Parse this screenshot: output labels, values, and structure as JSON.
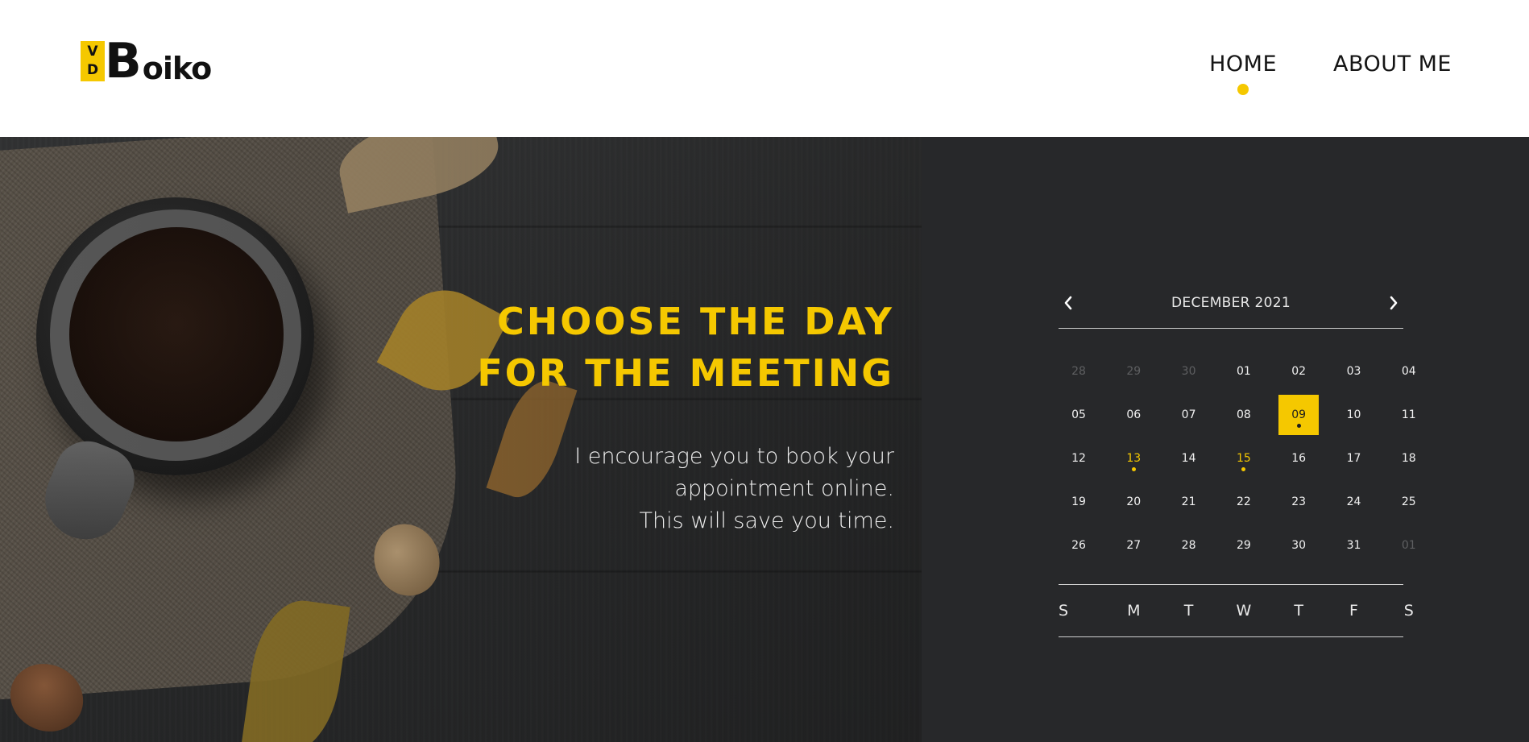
{
  "header": {
    "logo": {
      "mark_top": "V",
      "mark_bottom": "D",
      "big_letter": "B",
      "rest": "oiko"
    },
    "nav": [
      {
        "label": "HOME",
        "active": true
      },
      {
        "label": "ABOUT ME",
        "active": false
      }
    ]
  },
  "hero": {
    "title_line1": "CHOOSE THE DAY",
    "title_line2": "FOR THE MEETING",
    "sub_line1": "I encourage you to book your",
    "sub_line2": "appointment online.",
    "sub_line3": "This will save you time."
  },
  "calendar": {
    "month_label": "DECEMBER 2021",
    "prev_icon": "chevron-left-icon",
    "next_icon": "chevron-right-icon",
    "days": [
      {
        "label": "28",
        "muted": true
      },
      {
        "label": "29",
        "muted": true
      },
      {
        "label": "30",
        "muted": true
      },
      {
        "label": "01"
      },
      {
        "label": "02"
      },
      {
        "label": "03"
      },
      {
        "label": "04"
      },
      {
        "label": "05"
      },
      {
        "label": "06"
      },
      {
        "label": "07"
      },
      {
        "label": "08"
      },
      {
        "label": "09",
        "selected": true,
        "dot": true
      },
      {
        "label": "10"
      },
      {
        "label": "11"
      },
      {
        "label": "12"
      },
      {
        "label": "13",
        "event": true,
        "dot": true
      },
      {
        "label": "14"
      },
      {
        "label": "15",
        "event": true,
        "dot": true
      },
      {
        "label": "16"
      },
      {
        "label": "17"
      },
      {
        "label": "18"
      },
      {
        "label": "19"
      },
      {
        "label": "20"
      },
      {
        "label": "21"
      },
      {
        "label": "22"
      },
      {
        "label": "23"
      },
      {
        "label": "24"
      },
      {
        "label": "25"
      },
      {
        "label": "26"
      },
      {
        "label": "27"
      },
      {
        "label": "28"
      },
      {
        "label": "29"
      },
      {
        "label": "30"
      },
      {
        "label": "31"
      },
      {
        "label": "01",
        "muted": true
      }
    ],
    "weekdays": [
      "S",
      "M",
      "T",
      "W",
      "T",
      "F",
      "S"
    ]
  },
  "colors": {
    "accent": "#f5c800",
    "panel_bg": "#27282a",
    "hero_bg": "#2b2c2d",
    "header_bg": "#ffffff"
  }
}
